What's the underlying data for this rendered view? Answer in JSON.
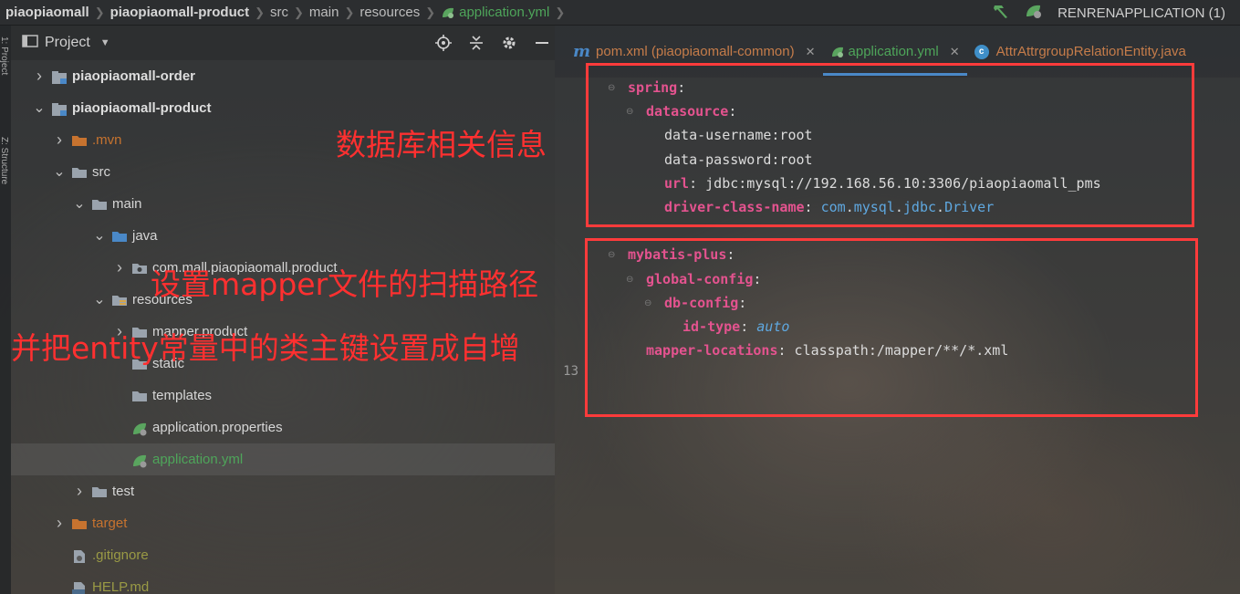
{
  "breadcrumb": [
    "piaopiaomall",
    "piaopiaomall-product",
    "src",
    "main",
    "resources",
    "application.yml"
  ],
  "run_config": "RENRENAPPLICATION (1)",
  "left_strip": {
    "project_tab": "1: Project",
    "structure_tab": "Z: Structure"
  },
  "project_panel": {
    "title": "Project",
    "tree": [
      {
        "label": "piaopiaomall-order",
        "indent": 1,
        "arrow": "collapsed",
        "style": "bold",
        "icon": "module"
      },
      {
        "label": "piaopiaomall-product",
        "indent": 1,
        "arrow": "expanded",
        "style": "bold",
        "icon": "module"
      },
      {
        "label": ".mvn",
        "indent": 2,
        "arrow": "collapsed",
        "style": "orange",
        "icon": "folder-orange"
      },
      {
        "label": "src",
        "indent": 2,
        "arrow": "expanded",
        "style": "normal",
        "icon": "folder"
      },
      {
        "label": "main",
        "indent": 3,
        "arrow": "expanded",
        "style": "normal",
        "icon": "folder"
      },
      {
        "label": "java",
        "indent": 4,
        "arrow": "expanded",
        "style": "normal",
        "icon": "folder-blue"
      },
      {
        "label": "com.mall.piaopiaomall.product",
        "indent": 5,
        "arrow": "collapsed",
        "style": "normal",
        "icon": "package"
      },
      {
        "label": "resources",
        "indent": 4,
        "arrow": "expanded",
        "style": "normal",
        "icon": "folder-res"
      },
      {
        "label": "mapper.product",
        "indent": 5,
        "arrow": "collapsed",
        "style": "normal",
        "icon": "folder"
      },
      {
        "label": "static",
        "indent": 5,
        "arrow": "none",
        "style": "normal",
        "icon": "folder"
      },
      {
        "label": "templates",
        "indent": 5,
        "arrow": "none",
        "style": "normal",
        "icon": "folder"
      },
      {
        "label": "application.properties",
        "indent": 5,
        "arrow": "none",
        "style": "normal",
        "icon": "spring-file"
      },
      {
        "label": "application.yml",
        "indent": 5,
        "arrow": "none",
        "style": "green",
        "icon": "spring-file",
        "selected": true
      },
      {
        "label": "test",
        "indent": 3,
        "arrow": "collapsed",
        "style": "normal",
        "icon": "folder"
      },
      {
        "label": "target",
        "indent": 2,
        "arrow": "collapsed",
        "style": "orange",
        "icon": "folder-orange"
      },
      {
        "label": ".gitignore",
        "indent": 2,
        "arrow": "none",
        "style": "olive",
        "icon": "file"
      },
      {
        "label": "HELP.md",
        "indent": 2,
        "arrow": "none",
        "style": "olive",
        "icon": "md-file"
      }
    ]
  },
  "editor": {
    "tabs": [
      {
        "label": "pom.xml (piaopiaomall-common)",
        "icon": "m",
        "active": false,
        "closable": true
      },
      {
        "label": "application.yml",
        "icon": "spring",
        "active": true,
        "closable": true
      },
      {
        "label": "AttrAttrgroupRelationEntity.java",
        "icon": "c",
        "active": false,
        "closable": false
      }
    ],
    "visible_line_number": "13",
    "code": [
      {
        "indent": 0,
        "parts": [
          {
            "t": "spring",
            "c": "k"
          },
          {
            "t": ":",
            "c": "p"
          }
        ]
      },
      {
        "indent": 1,
        "parts": [
          {
            "t": "datasource",
            "c": "k"
          },
          {
            "t": ":",
            "c": "p"
          }
        ]
      },
      {
        "indent": 2,
        "parts": [
          {
            "t": "data-username:root",
            "c": "v"
          }
        ]
      },
      {
        "indent": 2,
        "parts": [
          {
            "t": "data-password:root",
            "c": "v"
          }
        ]
      },
      {
        "indent": 2,
        "parts": [
          {
            "t": "url",
            "c": "k"
          },
          {
            "t": ": jdbc:mysql://192.168.56.10:3306/piaopiaomall_pms",
            "c": "v"
          }
        ]
      },
      {
        "indent": 2,
        "parts": [
          {
            "t": "driver-class-name",
            "c": "k"
          },
          {
            "t": ": ",
            "c": "p"
          },
          {
            "t": "com",
            "c": "b"
          },
          {
            "t": ".",
            "c": "p"
          },
          {
            "t": "mysql",
            "c": "b"
          },
          {
            "t": ".",
            "c": "p"
          },
          {
            "t": "jdbc",
            "c": "b"
          },
          {
            "t": ".",
            "c": "p"
          },
          {
            "t": "Driver",
            "c": "b"
          }
        ]
      },
      {
        "indent": 0,
        "parts": []
      },
      {
        "indent": 0,
        "parts": [
          {
            "t": "mybatis-plus",
            "c": "k"
          },
          {
            "t": ":",
            "c": "p"
          }
        ]
      },
      {
        "indent": 1,
        "parts": [
          {
            "t": "global-config",
            "c": "k"
          },
          {
            "t": ":",
            "c": "p"
          }
        ]
      },
      {
        "indent": 2,
        "parts": [
          {
            "t": "db-config",
            "c": "k"
          },
          {
            "t": ":",
            "c": "p"
          }
        ]
      },
      {
        "indent": 3,
        "parts": [
          {
            "t": "id-type",
            "c": "k"
          },
          {
            "t": ": ",
            "c": "p"
          },
          {
            "t": "auto",
            "c": "i"
          }
        ]
      },
      {
        "indent": 1,
        "parts": [
          {
            "t": "mapper-locations",
            "c": "k"
          },
          {
            "t": ": classpath:/mapper/**/*.xml",
            "c": "v"
          }
        ]
      }
    ]
  },
  "annotations": {
    "db_info": "数据库相关信息",
    "mapper_path": "设置mapper文件的扫描路径",
    "entity_autoinc": "并把entity常量中的类主键设置成自增"
  },
  "colors": {
    "annotation_red": "#ff3b3b",
    "yaml_key": "#e4538f",
    "spring_green": "#4ea55a",
    "excluded_orange": "#c7732f"
  }
}
